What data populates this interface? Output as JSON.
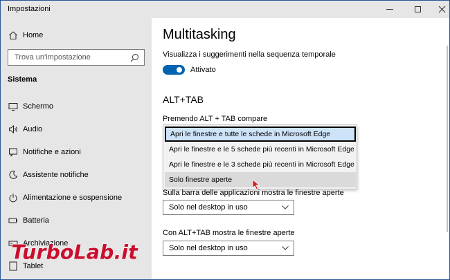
{
  "window": {
    "title": "Impostazioni"
  },
  "sidebar": {
    "home_label": "Home",
    "search_placeholder": "Trova un'impostazione",
    "section_title": "Sistema",
    "items": [
      {
        "label": "Schermo",
        "icon": "monitor-icon"
      },
      {
        "label": "Audio",
        "icon": "speaker-icon"
      },
      {
        "label": "Notifiche e azioni",
        "icon": "notification-icon"
      },
      {
        "label": "Assistente notifiche",
        "icon": "moon-icon"
      },
      {
        "label": "Alimentazione e sospensione",
        "icon": "power-icon"
      },
      {
        "label": "Batteria",
        "icon": "battery-icon"
      },
      {
        "label": "Archiviazione",
        "icon": "storage-icon"
      },
      {
        "label": "Tablet",
        "icon": "tablet-icon"
      }
    ]
  },
  "main": {
    "title": "Multitasking",
    "suggestions_label": "Visualizza i suggerimenti nella sequenza temporale",
    "toggle_state": "Attivato",
    "alttab_heading": "ALT+TAB",
    "alttab_label": "Premendo ALT + TAB compare",
    "alttab_options": [
      "Apri le finestre e tutte le schede in Microsoft Edge",
      "Apri le finestre e le 5 schede più recenti in Microsoft Edge",
      "Apri le finestre e le 3 schede più recenti in Microsoft Edge",
      "Solo finestre aperte"
    ],
    "taskbar_label": "Sulla barra delle applicazioni mostra le finestre aperte",
    "taskbar_value": "Solo nel desktop in uso",
    "alttab2_label": "Con ALT+TAB mostra le finestre aperte",
    "alttab2_value": "Solo nel desktop in uso"
  },
  "watermark": {
    "text": "TurboLab.it"
  },
  "colors": {
    "accent": "#0063b1",
    "sidebar_bg": "#e6e6e6",
    "selected_option_bg": "#cde3f7"
  }
}
